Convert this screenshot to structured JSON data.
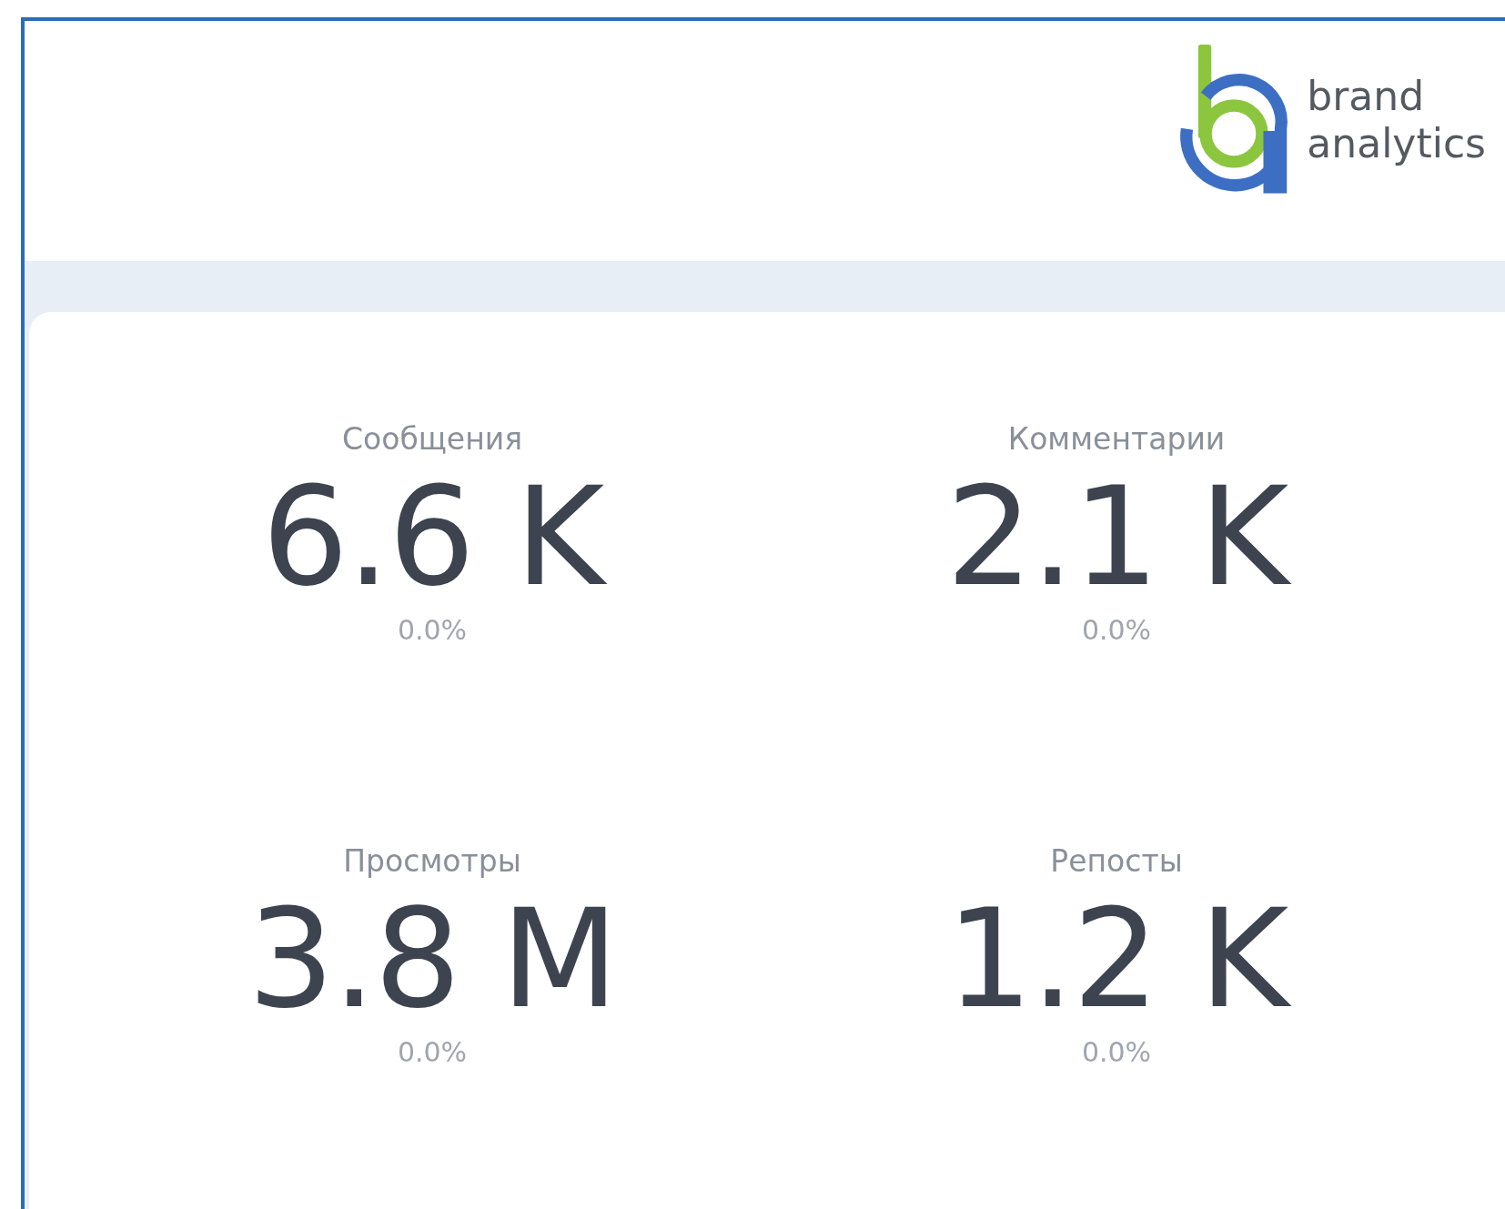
{
  "logo": {
    "lines": [
      "brand",
      "analytics"
    ]
  },
  "metrics": [
    {
      "label": "Сообщения",
      "value": "6.6 K",
      "change": "0.0%"
    },
    {
      "label": "Комментарии",
      "value": "2.1 K",
      "change": "0.0%"
    },
    {
      "label": "Просмотры",
      "value": "3.8 M",
      "change": "0.0%"
    },
    {
      "label": "Репосты",
      "value": "1.2 K",
      "change": "0.0%"
    }
  ]
}
